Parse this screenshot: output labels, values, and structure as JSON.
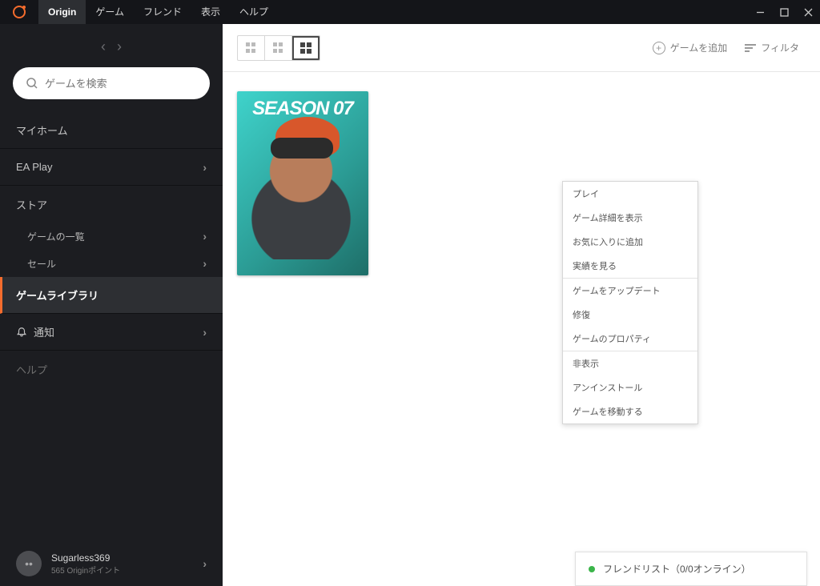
{
  "titlebar": {
    "brand": "Origin",
    "menus": [
      "ゲーム",
      "フレンド",
      "表示",
      "ヘルプ"
    ]
  },
  "sidebar": {
    "search_placeholder": "ゲームを検索",
    "items": {
      "my_home": "マイホーム",
      "ea_play": "EA Play",
      "store": "ストア",
      "game_list": "ゲームの一覧",
      "sale": "セール",
      "game_library": "ゲームライブラリ",
      "notifications": "通知",
      "help": "ヘルプ"
    },
    "user": {
      "name": "Sugarless369",
      "points": "565 Originポイント"
    }
  },
  "toolbar": {
    "add_game": "ゲームを追加",
    "filter": "フィルタ"
  },
  "game": {
    "title_overlay": "SEASON 07"
  },
  "context_menu": {
    "play": "プレイ",
    "show_details": "ゲーム詳細を表示",
    "add_favorite": "お気に入りに追加",
    "view_achievements": "実績を見る",
    "update_game": "ゲームをアップデート",
    "repair": "修復",
    "properties": "ゲームのプロパティ",
    "hide": "非表示",
    "uninstall": "アンインストール",
    "move_game": "ゲームを移動する"
  },
  "friends_pop": {
    "text": "フレンドリスト（0/0オンライン）"
  }
}
